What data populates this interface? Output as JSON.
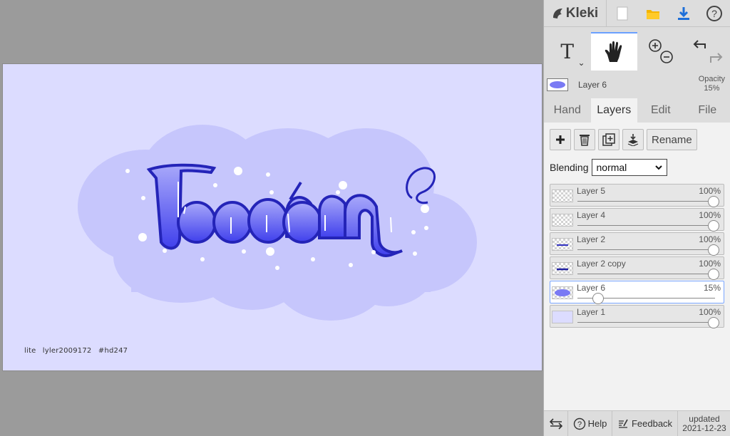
{
  "app": {
    "name": "Kleki"
  },
  "topbar": {
    "icons": [
      "new-image-icon",
      "open-folder-icon",
      "download-icon",
      "help-circle-icon"
    ],
    "help_glyph": "?"
  },
  "tools": {
    "text_glyph": "T",
    "caret_glyph": "⌄"
  },
  "layer_info": {
    "active_layer": "Layer 6",
    "opacity_label": "Opacity",
    "opacity_value": "15%"
  },
  "tabs": [
    {
      "label": "Hand",
      "active": false
    },
    {
      "label": "Layers",
      "active": true
    },
    {
      "label": "Edit",
      "active": false
    },
    {
      "label": "File",
      "active": false
    }
  ],
  "layers_panel": {
    "rename_label": "Rename",
    "blending_label": "Blending",
    "blending_value": "normal",
    "layers": [
      {
        "name": "Layer 5",
        "opacity": "100%",
        "opacity_value": 1.0,
        "selected": false,
        "thumb": "empty"
      },
      {
        "name": "Layer 4",
        "opacity": "100%",
        "opacity_value": 1.0,
        "selected": false,
        "thumb": "empty"
      },
      {
        "name": "Layer 2",
        "opacity": "100%",
        "opacity_value": 1.0,
        "selected": false,
        "thumb": "text"
      },
      {
        "name": "Layer 2 copy",
        "opacity": "100%",
        "opacity_value": 1.0,
        "selected": false,
        "thumb": "text"
      },
      {
        "name": "Layer 6",
        "opacity": "15%",
        "opacity_value": 0.15,
        "selected": true,
        "thumb": "cloud"
      },
      {
        "name": "Layer 1",
        "opacity": "100%",
        "opacity_value": 1.0,
        "selected": false,
        "thumb": "fill"
      }
    ]
  },
  "canvas": {
    "signature": "lite  lyler2009172  #hd247",
    "colors": {
      "background": "#dcdcff",
      "cloud": "#c6c6fc",
      "letters_top": "#9f9ff8",
      "letters_bottom": "#4545ee",
      "outline": "#2424b8"
    }
  },
  "bottombar": {
    "help_label": "Help",
    "feedback_label": "Feedback",
    "updated_label": "updated",
    "updated_date": "2021-12-23"
  }
}
